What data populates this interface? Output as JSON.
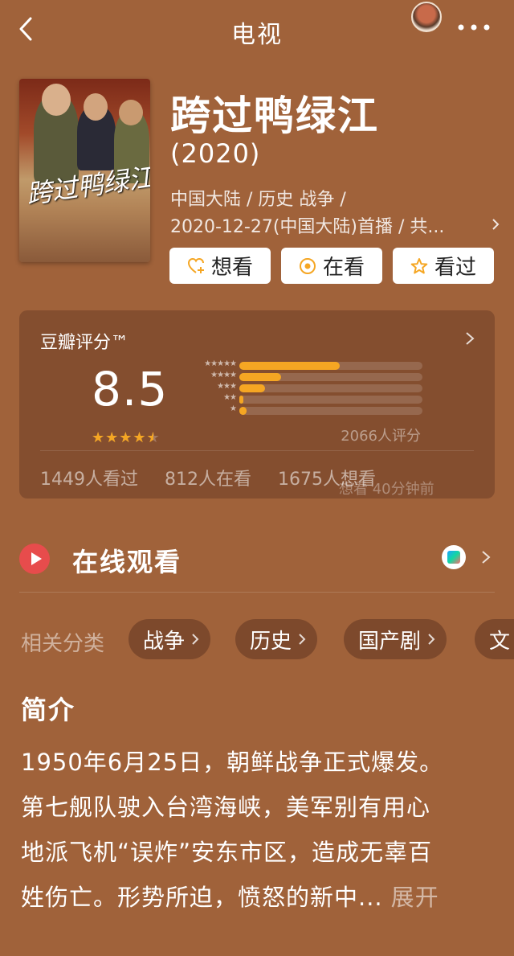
{
  "topbar": {
    "title": "电视"
  },
  "movie": {
    "title": "跨过鸭绿江",
    "year": "(2020)",
    "meta_line1": "中国大陆 / 历史 战争 /",
    "meta_line2": "2020-12-27(中国大陆)首播 / 共...",
    "poster_text": "跨过鸭绿江"
  },
  "actions": {
    "want": "想看",
    "watching": "在看",
    "watched": "看过"
  },
  "rating": {
    "label": "豆瓣评分™",
    "score": "8.5",
    "stars": "★★★★★",
    "star_value": 4.5,
    "distribution": [
      0.55,
      0.23,
      0.14,
      0.02,
      0.04
    ],
    "count": "2066人评分",
    "watched": "1449人看过",
    "watching": "812人在看",
    "want": "1675人想看",
    "toast": "想看  40分钟前",
    "accent": "#f5a623"
  },
  "online": {
    "title": "在线观看"
  },
  "categories": {
    "label": "相关分类",
    "items": [
      "战争",
      "历史",
      "国产剧",
      "文"
    ]
  },
  "intro": {
    "heading": "简介",
    "lines": [
      "1950年6月25日，朝鲜战争正式爆发。",
      "第七舰队驶入台湾海峡，美军别有用心",
      "地派飞机“误炸”安东市区，造成无辜百",
      "姓伤亡。形势所迫，愤怒的新中..."
    ],
    "expand": "展开"
  }
}
